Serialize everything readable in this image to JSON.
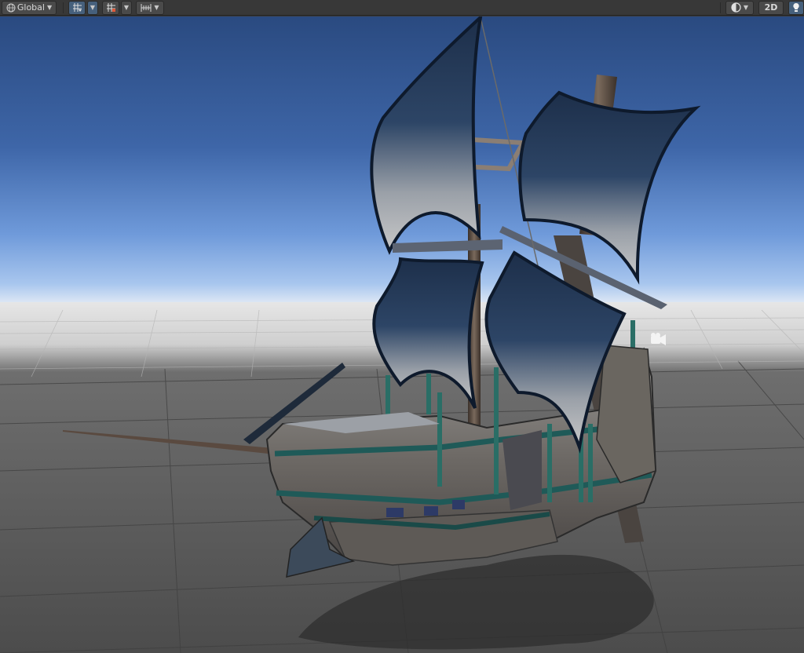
{
  "toolbar": {
    "pivot_rotation_label": "Global",
    "mode_2d_label": "2D"
  },
  "icons": {
    "globe": "globe-icon",
    "grid_snap": "grid-snap-icon",
    "increment_snap": "increment-snap-icon",
    "ruler": "ruler-icon",
    "draw_mode": "draw-mode-icon",
    "lighting": "lighting-bulb-icon",
    "camera_gizmo": "camera-icon"
  },
  "colors": {
    "toolbar_bg": "#383838",
    "active_blue": "#46607c",
    "sky_top": "#2c4e85",
    "sky_horizon": "#8fb6e8",
    "ground": "#5a5a5a"
  }
}
